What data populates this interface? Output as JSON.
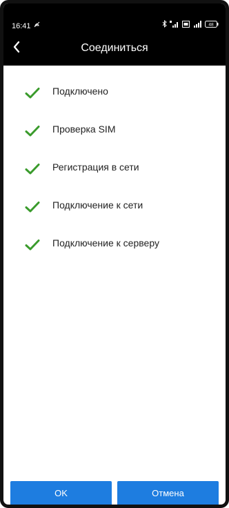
{
  "status_bar": {
    "time": "16:41",
    "battery": "48"
  },
  "header": {
    "title": "Соединиться"
  },
  "steps": [
    {
      "label": "Подключено",
      "status": "done"
    },
    {
      "label": "Проверка SIM",
      "status": "done"
    },
    {
      "label": "Регистрация в сети",
      "status": "done"
    },
    {
      "label": "Подключение к сети",
      "status": "done"
    },
    {
      "label": "Подключение к серверу",
      "status": "done"
    }
  ],
  "buttons": {
    "ok_label": "OK",
    "cancel_label": "Отмена"
  },
  "colors": {
    "accent": "#1e7de0",
    "check": "#3a9b2c",
    "header_bg": "#000000"
  },
  "icons": {
    "back": "chevron-left-icon",
    "step": "check-icon"
  }
}
